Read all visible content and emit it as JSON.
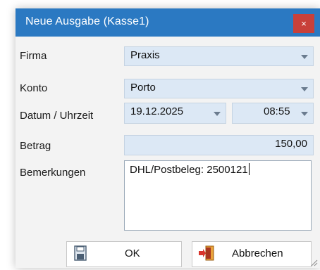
{
  "window": {
    "title": "Neue Ausgabe (Kasse1)",
    "close_glyph": "×"
  },
  "form": {
    "firma_label": "Firma",
    "firma_value": "Praxis",
    "konto_label": "Konto",
    "konto_value": "Porto",
    "datum_label": "Datum / Uhrzeit",
    "datum_value": "19.12.2025",
    "uhrzeit_value": "08:55",
    "betrag_label": "Betrag",
    "betrag_value": "150,00",
    "bemerkungen_label": "Bemerkungen",
    "bemerkungen_value": "DHL/Postbeleg: 2500121"
  },
  "buttons": {
    "ok_label": "OK",
    "cancel_label": "Abbrechen"
  },
  "colors": {
    "titlebar": "#2b79c2",
    "close": "#c8403a",
    "field_bg": "#dce8f5"
  },
  "icons": {
    "ok": "save-disk-icon",
    "cancel": "exit-door-icon",
    "dropdown": "chevron-down-icon"
  }
}
